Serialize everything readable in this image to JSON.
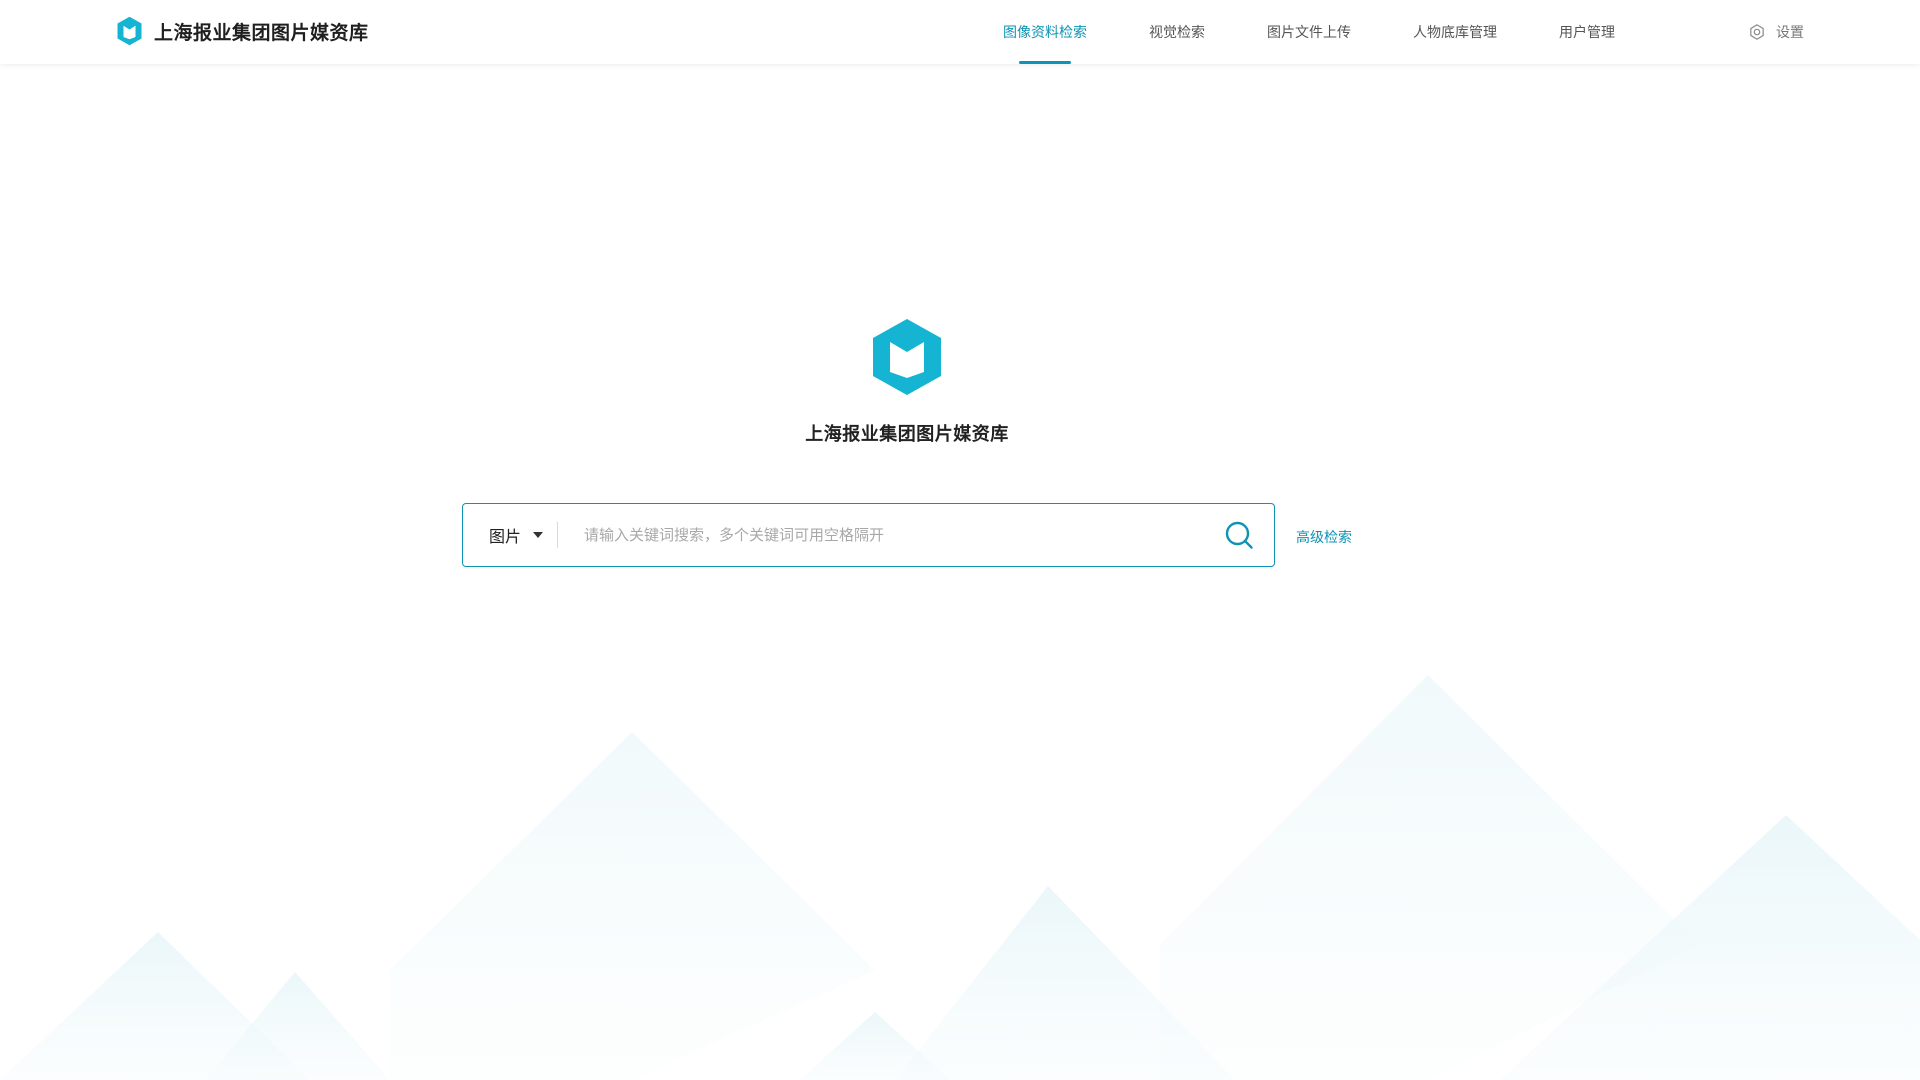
{
  "app": {
    "title": "上海报业集团图片媒资库"
  },
  "colors": {
    "accent": "#0d93b3",
    "logo": "#14b4d2"
  },
  "header": {
    "brand_icon": "hexagon-book-logo",
    "brand_title": "上海报业集团图片媒资库",
    "nav": [
      {
        "label": "图像资料检索",
        "active": true
      },
      {
        "label": "视觉检索",
        "active": false
      },
      {
        "label": "图片文件上传",
        "active": false
      },
      {
        "label": "人物底库管理",
        "active": false
      },
      {
        "label": "用户管理",
        "active": false
      }
    ],
    "settings_icon": "gear-icon",
    "settings_label": "设置"
  },
  "hero": {
    "logo_icon": "hexagon-book-logo",
    "title": "上海报业集团图片媒资库"
  },
  "search": {
    "type_selected": "图片",
    "placeholder": "请输入关键词搜索，多个关键词可用空格隔开",
    "value": "",
    "search_icon": "search-icon",
    "advanced_label": "高级检索"
  }
}
